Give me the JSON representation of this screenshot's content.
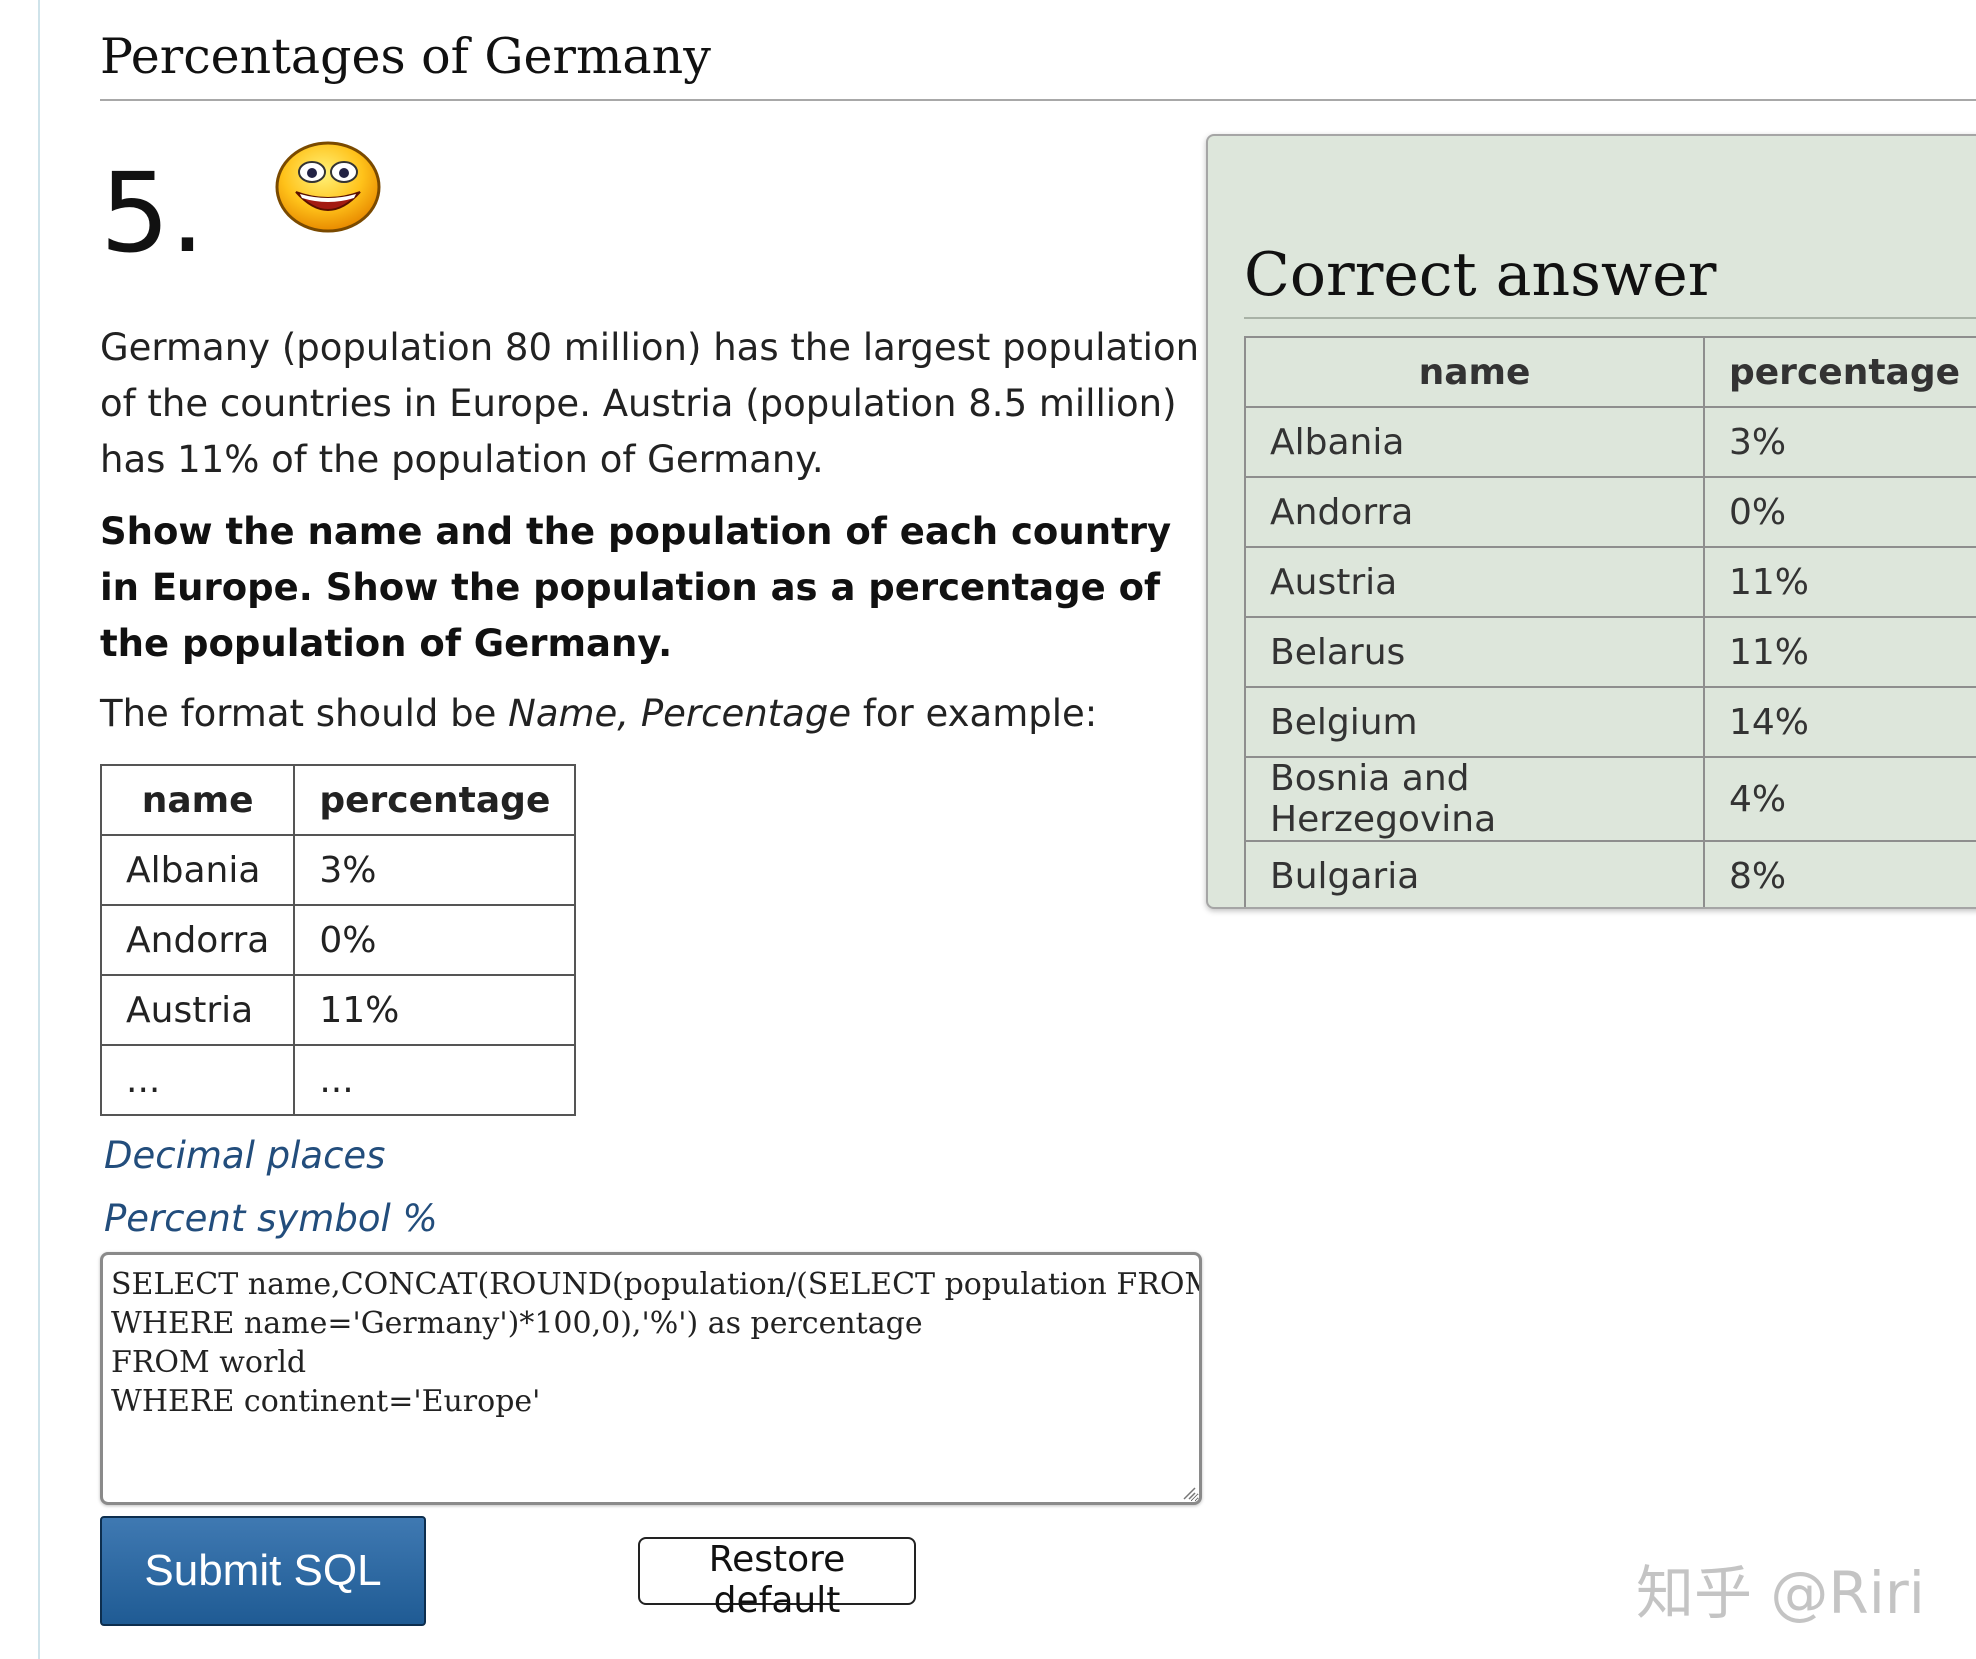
{
  "page": {
    "title": "Percentages of Germany"
  },
  "question": {
    "number": "5.",
    "smiley_icon": "laughing-face-icon",
    "text": "Germany (population 80 million) has the largest population of the countries in Europe. Austria (population 8.5 million) has 11% of the population of Germany.",
    "task": "Show the name and the population of each country in Europe. Show the population as a percentage of the population of Germany.",
    "format_prefix": "The format should be ",
    "format_em": "Name, Percentage",
    "format_suffix": " for example:"
  },
  "example_table": {
    "headers": [
      "name",
      "percentage"
    ],
    "rows": [
      [
        "Albania",
        "3%"
      ],
      [
        "Andorra",
        "0%"
      ],
      [
        "Austria",
        "11%"
      ],
      [
        "...",
        "..."
      ]
    ]
  },
  "hints": {
    "decimal": "Decimal places",
    "percent": "Percent symbol %"
  },
  "editor": {
    "sql": "SELECT name,CONCAT(ROUND(population/(SELECT population FROM world\nWHERE name='Germany')*100,0),'%') as percentage\nFROM world\nWHERE continent='Europe'"
  },
  "buttons": {
    "submit": "Submit SQL",
    "restore": "Restore default"
  },
  "answer": {
    "title": "Correct answer",
    "headers": [
      "name",
      "percentage"
    ],
    "rows": [
      [
        "Albania",
        "3%"
      ],
      [
        "Andorra",
        "0%"
      ],
      [
        "Austria",
        "11%"
      ],
      [
        "Belarus",
        "11%"
      ],
      [
        "Belgium",
        "14%"
      ],
      [
        "Bosnia and Herzegovina",
        "4%"
      ],
      [
        "Bulgaria",
        "8%"
      ]
    ]
  },
  "watermark": "知乎 @Riri",
  "colors": {
    "answer_panel_bg": "#dde6db",
    "hint_link": "#224d7c",
    "submit_button": "#2a65a0"
  }
}
